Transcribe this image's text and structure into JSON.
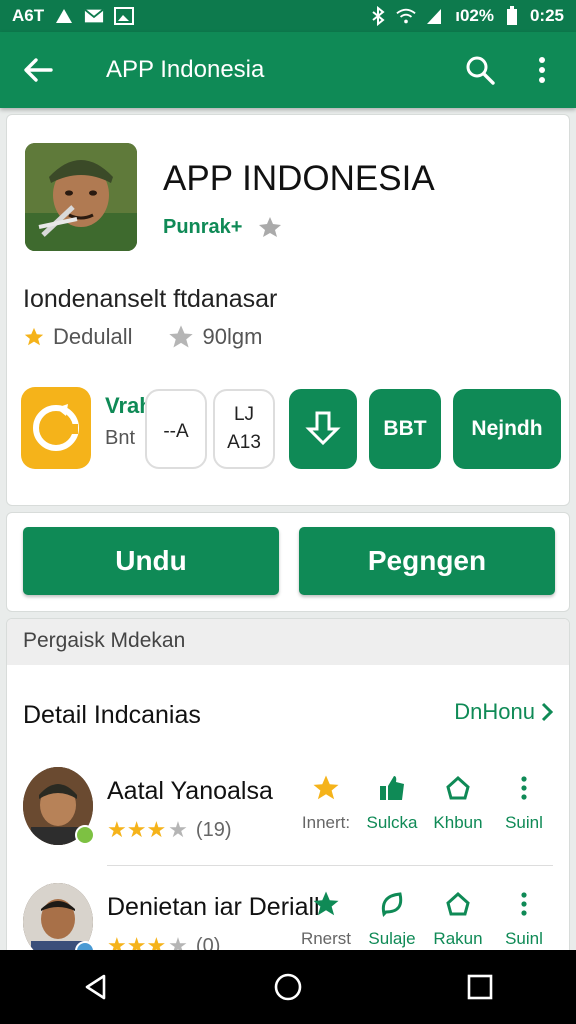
{
  "status_bar": {
    "carrier": "A6T",
    "battery": " ı02%",
    "time": "0:25"
  },
  "app_bar": {
    "title": "APP Indonesia"
  },
  "app": {
    "name": "APP INDONESIA",
    "developer": "Punrak+",
    "description": "Iondenanselt ftdanasar",
    "rating_label": "Dedulall",
    "downloads": "90lgm"
  },
  "features": {
    "title": "Vrahonu",
    "subtitle": "Bnt",
    "chip1": {
      "line1": "",
      "line2": "--A"
    },
    "chip2": {
      "line1": "LJ",
      "line2": "A13"
    },
    "green2": "BBT",
    "green3": "Nejndh"
  },
  "buttons": {
    "primary": "Undu",
    "secondary": "Pegngen"
  },
  "reviews_section": {
    "sub_header": "Pergaisk Mdekan",
    "title": "Detail Indcanias",
    "link": "DnHonu"
  },
  "reviews": [
    {
      "name": "Aatal Yanoalsa",
      "rating_count": "(19)",
      "rating_stars": 3,
      "actions": [
        "Innert:",
        "Sulcka",
        "Khbun",
        "Suinl"
      ]
    },
    {
      "name": "Denietan iar Deriall",
      "rating_count": "(0)",
      "rating_stars": 3,
      "actions": [
        "Rnerst",
        "Sulaje",
        "Rakun",
        "Suinl"
      ]
    }
  ],
  "colors": {
    "primary_green": "#0f8a56",
    "status_green": "#0d7a4d",
    "accent_yellow": "#f5b31a"
  },
  "icons": {
    "back": "arrow-left-icon",
    "search": "search-icon",
    "more": "more-vert-icon"
  }
}
